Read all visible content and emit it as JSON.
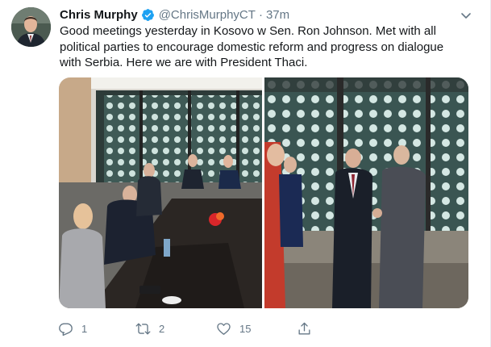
{
  "tweet": {
    "author_name": "Chris Murphy",
    "verified": true,
    "handle": "@ChrisMurphyCT",
    "separator": "·",
    "time": "37m",
    "text": "Good meetings yesterday in Kosovo w Sen. Ron Johnson. Met with all political parties to encourage domestic reform and progress on dialogue with Serbia. Here we are with President Thaci.",
    "media": [
      {
        "kind": "photo",
        "subject": "meeting-table"
      },
      {
        "kind": "photo",
        "subject": "handshake"
      }
    ],
    "actions": {
      "reply_count": "1",
      "retweet_count": "2",
      "like_count": "15"
    }
  },
  "icons": {
    "verified": "verified-badge-icon",
    "caret": "chevron-down-icon",
    "reply": "reply-icon",
    "retweet": "retweet-icon",
    "like": "heart-icon",
    "share": "share-icon"
  },
  "colors": {
    "text": "#14171a",
    "secondary": "#657786",
    "verified_blue": "#1da1f2",
    "divider": "#e6ecf0"
  }
}
